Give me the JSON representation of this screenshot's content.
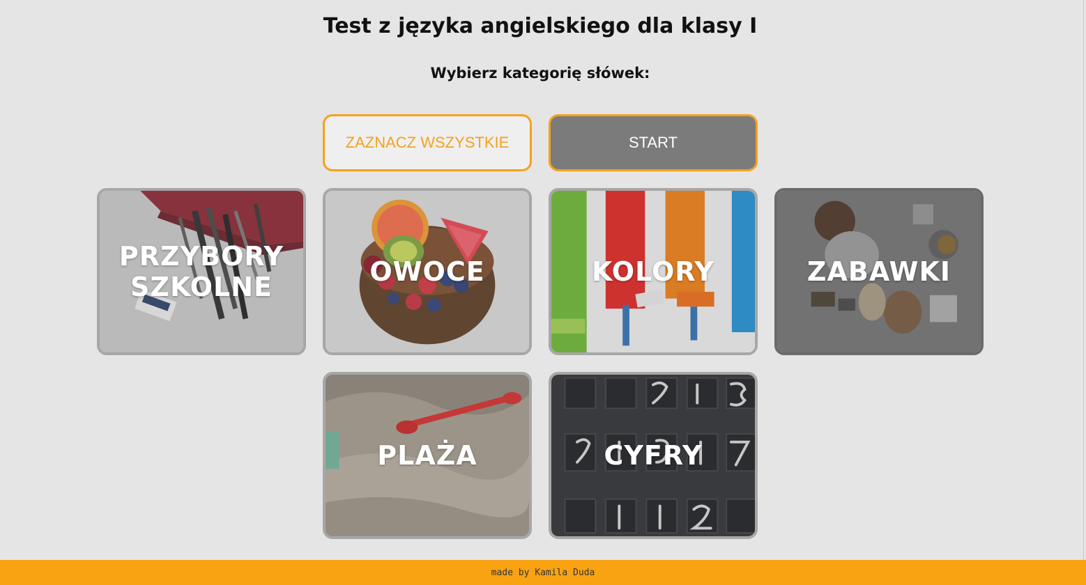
{
  "header": {
    "title": "Test z języka angielskiego dla klasy I",
    "subtitle": "Wybierz kategorię słówek:"
  },
  "buttons": {
    "select_all": "ZAZNACZ WSZYSTKIE",
    "start": "START"
  },
  "categories": [
    {
      "label_line1": "PRZYBORY",
      "label_line2": "SZKOLNE",
      "image": "school-supplies-image"
    },
    {
      "label_line1": "OWOCE",
      "image": "fruit-bowl-image"
    },
    {
      "label_line1": "KOLORY",
      "image": "paint-rollers-image"
    },
    {
      "label_line1": "ZABAWKI",
      "image": "toys-image"
    },
    {
      "label_line1": "PLAŻA",
      "image": "beach-sand-image"
    },
    {
      "label_line1": "CYFRY",
      "image": "numbers-board-image"
    }
  ],
  "footer": {
    "text": "made by Kamila Duda"
  },
  "colors": {
    "accent": "#f5a11c",
    "background": "#e5e5e5",
    "start_button": "#7b7b7b",
    "footer": "#f9a313"
  }
}
